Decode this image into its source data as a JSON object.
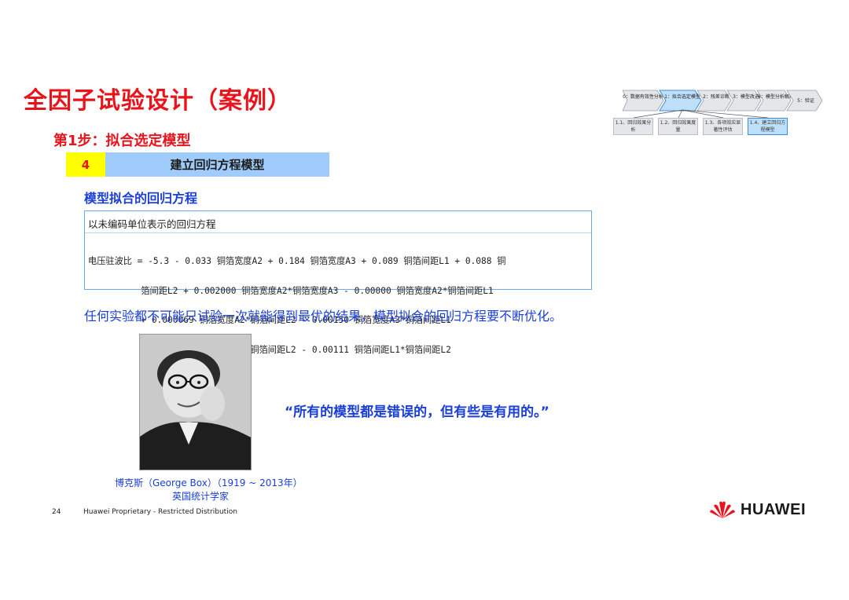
{
  "header": {
    "title": "全因子试验设计（案例）",
    "step_title": "第1步：拟合选定模型"
  },
  "process_flow": {
    "steps": [
      "0：数据有效性分析",
      "1：拟合选定模型",
      "2：残差诊断",
      "3：模型改进",
      "4：模型分析解释",
      "5：验证"
    ],
    "active_step": 1,
    "sub_steps": [
      "1.1、回归效果分析",
      "1.2、回归效果度量",
      "1.3、各项效应显著性评估",
      "1.4、建立回归方程模型"
    ],
    "active_sub_step": 3,
    "colors": {
      "active": "#3c8de0",
      "inactive": "#e4e6ea"
    }
  },
  "step_banner": {
    "number": "4",
    "label": "建立回归方程模型"
  },
  "section": {
    "title": "模型拟合的回归方程"
  },
  "equation": {
    "caption": "以未编码单位表示的回归方程",
    "lines": [
      "电压驻波比 = -5.3 - 0.033 铜箔宽度A2 + 0.184 铜箔宽度A3 + 0.089 铜箔间距L1 + 0.088 铜",
      "          箔间距L2 + 0.002000 铜箔宽度A2*铜箔宽度A3 - 0.00000 铜箔宽度A2*铜箔间距L1",
      "          + 0.000069 铜箔宽度A2*铜箔间距L2 - 0.00150 铜箔宽度A3*铜箔间距L1",
      "          - 0.001222 铜箔宽度A3*铜箔间距L2 - 0.00111 铜箔间距L1*铜箔间距L2"
    ]
  },
  "note": "任何实验都不可能只试验一次就能得到最优的结果，模型拟合的回归方程要不断优化。",
  "quote": "“所有的模型都是错误的，但有些是有用的。”",
  "photo_caption": {
    "line1": "博克斯（George Box）（1919 ~ 2013年）",
    "line2": "英国统计学家"
  },
  "footer": {
    "page_number": "24",
    "text": "Huawei Proprietary - Restricted Distribution",
    "brand": "HUAWEI"
  },
  "colors": {
    "title_red": "#e8141c",
    "blue_text": "#1a3fd6",
    "banner_yellow": "#ffff00",
    "banner_blue": "#9fccfb"
  }
}
